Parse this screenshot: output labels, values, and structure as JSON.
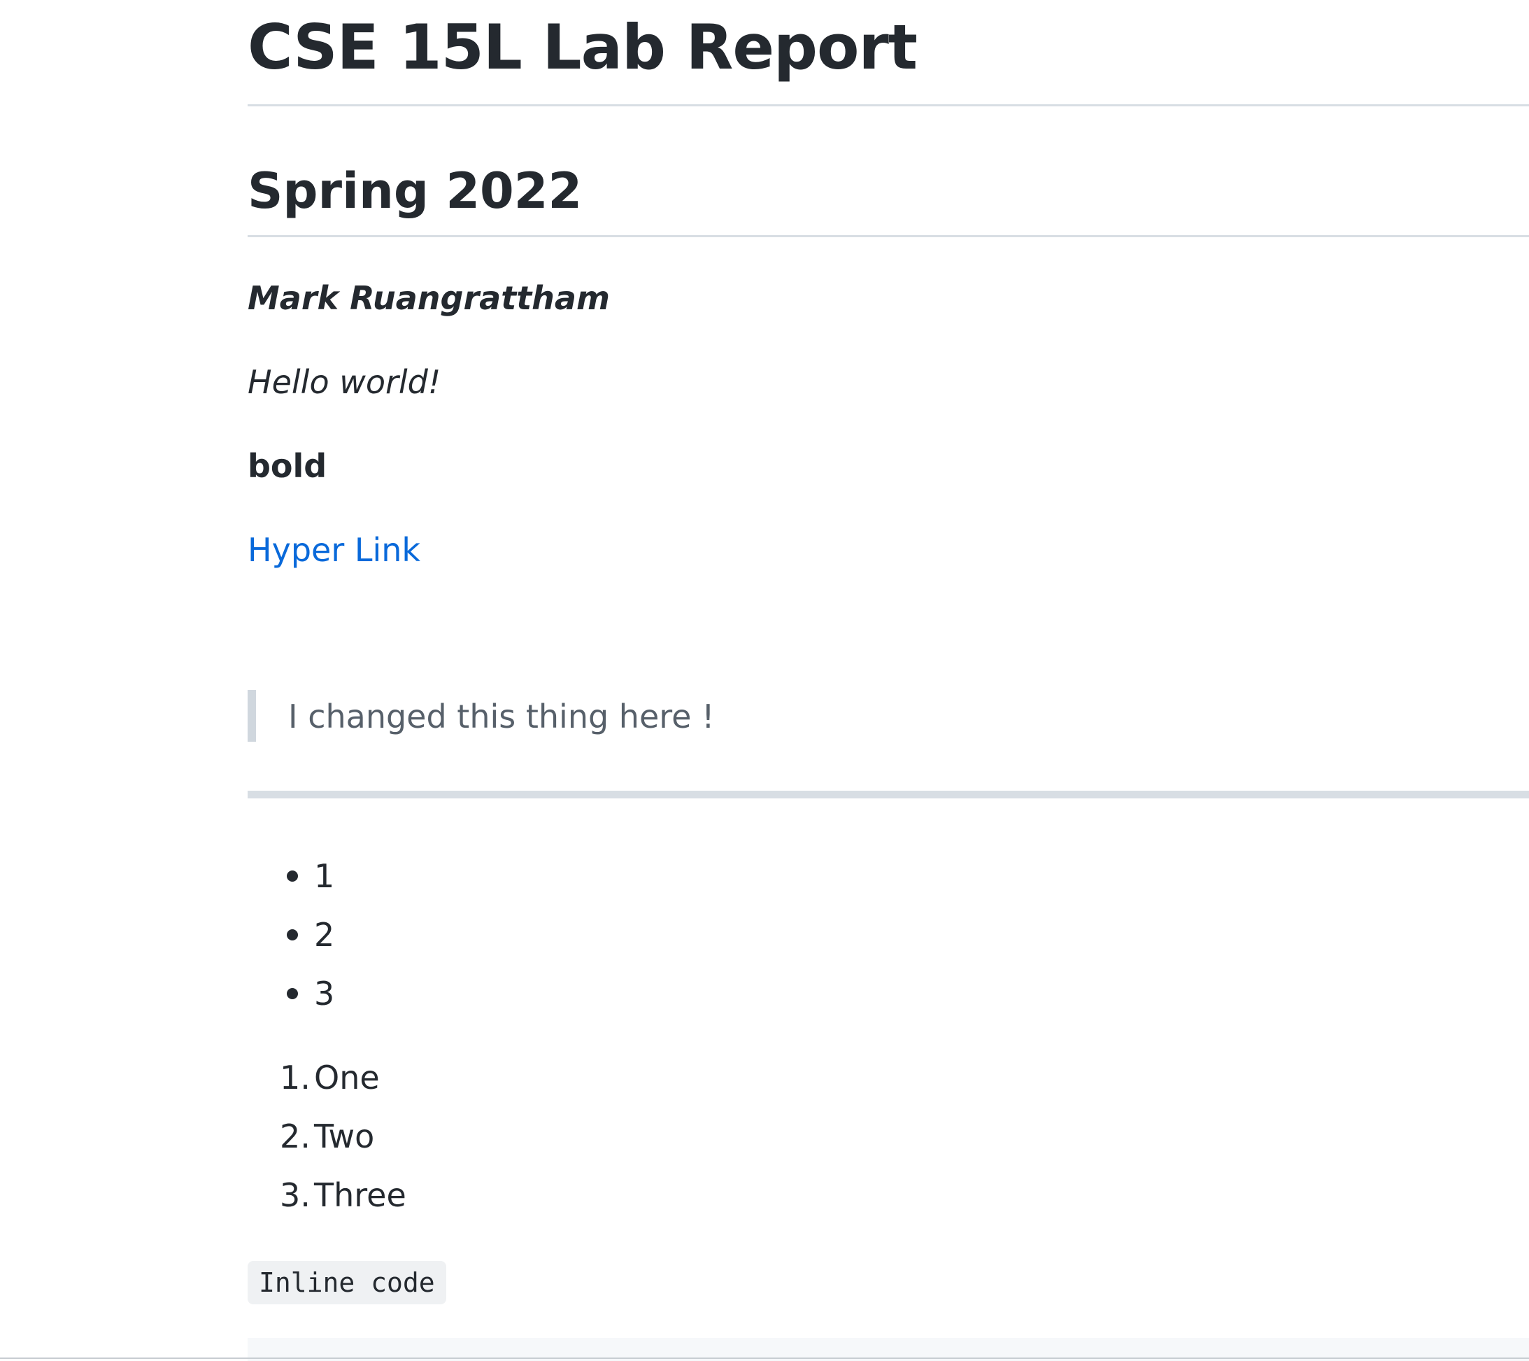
{
  "document": {
    "title": "CSE 15L Lab Report",
    "subtitle": "Spring 2022",
    "author": "Mark Ruangrattham",
    "italic_text": "Hello world!",
    "bold_text": "bold",
    "link_text": "Hyper Link",
    "blockquote": "I changed this thing here !",
    "bullet_list": [
      "1",
      "2",
      "3"
    ],
    "ordered_list": [
      {
        "number": "1.",
        "label": "One"
      },
      {
        "number": "2.",
        "label": "Two"
      },
      {
        "number": "3.",
        "label": "Three"
      }
    ],
    "inline_code": "Inline code"
  },
  "colors": {
    "text": "#24292f",
    "link": "#0969da",
    "quote_text": "#57606a",
    "rule": "#d8dee4",
    "code_bg": "#eff1f3"
  }
}
